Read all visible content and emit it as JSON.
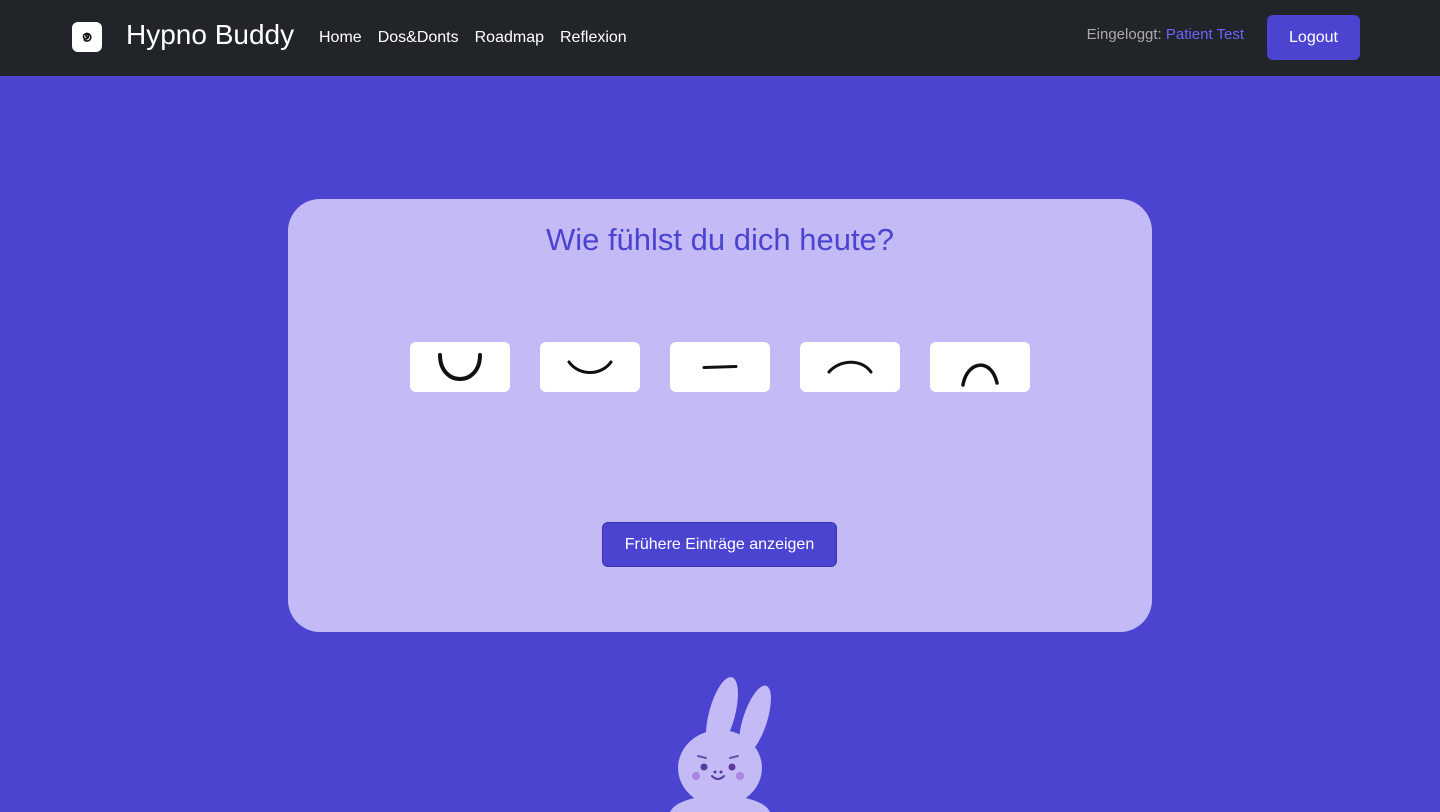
{
  "nav": {
    "brand": "Hypno Buddy",
    "logo_icon": "spiral-icon",
    "links": [
      "Home",
      "Dos&Donts",
      "Roadmap",
      "Reflexion"
    ],
    "login_label": "Eingeloggt: ",
    "login_user": "Patient Test",
    "logout_label": "Logout"
  },
  "main": {
    "title": "Wie fühlst du dich heute?",
    "moods": [
      {
        "icon": "very-happy-mouth-icon"
      },
      {
        "icon": "happy-mouth-icon"
      },
      {
        "icon": "neutral-mouth-icon"
      },
      {
        "icon": "sad-mouth-icon"
      },
      {
        "icon": "very-sad-mouth-icon"
      }
    ],
    "entries_button": "Frühere Einträge anzeigen"
  },
  "colors": {
    "background": "#4b44d1",
    "navbar": "#212529",
    "card": "#c3baf6",
    "accent": "#4b44d1",
    "bunny": "#c3baf6"
  }
}
